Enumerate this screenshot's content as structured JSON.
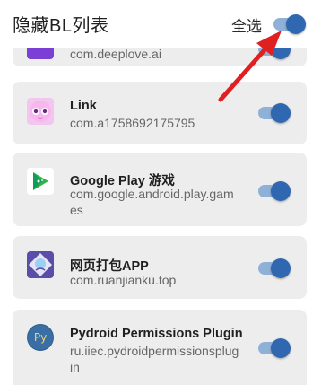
{
  "header": {
    "title": "隐藏BL列表",
    "select_all_label": "全选",
    "select_all_on": true
  },
  "apps": [
    {
      "name": "",
      "package": "com.deeplove.ai",
      "enabled": true,
      "icon": "purple-app-icon"
    },
    {
      "name": "Link",
      "package": "com.a1758692175795",
      "enabled": true,
      "icon": "pink-character-icon"
    },
    {
      "name": "Google Play 游戏",
      "package": "com.google.android.play.games",
      "enabled": true,
      "icon": "google-play-games-icon"
    },
    {
      "name": "网页打包APP",
      "package": "com.ruanjianku.top",
      "enabled": true,
      "icon": "web-package-icon"
    },
    {
      "name": "Pydroid Permissions Plugin",
      "package": "ru.iiec.pydroidpermissionsplugin",
      "enabled": true,
      "icon": "pydroid-icon"
    }
  ],
  "colors": {
    "toggle_track": "#8fb1d8",
    "toggle_knob": "#2f68b0",
    "card_bg": "#ededed",
    "annotation_arrow": "#e02020"
  }
}
